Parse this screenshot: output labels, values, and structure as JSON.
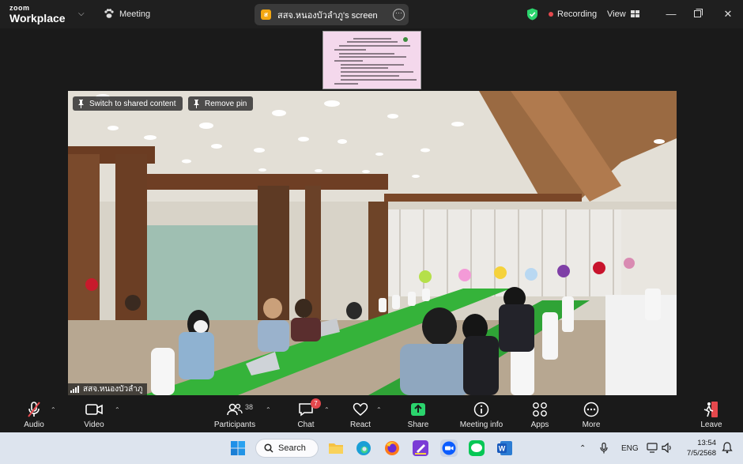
{
  "app": {
    "logo_small": "zoom",
    "logo_big": "Workplace",
    "meeting_label": "Meeting"
  },
  "share": {
    "label": "สสจ.หนองบัวลำภู's screen",
    "avatar_letter": "ส",
    "avatar_color": "#f3a712"
  },
  "status": {
    "recording_label": "Recording",
    "view_label": "View"
  },
  "overlay": {
    "switch_label": "Switch to shared content",
    "remove_pin_label": "Remove pin"
  },
  "video": {
    "participant_name": "สสจ.หนองบัวลำภู"
  },
  "toolbar": {
    "audio": "Audio",
    "video": "Video",
    "participants": "Participants",
    "participants_count": "38",
    "chat": "Chat",
    "chat_badge": "7",
    "react": "React",
    "share": "Share",
    "meeting_info": "Meeting info",
    "apps": "Apps",
    "more": "More",
    "leave": "Leave"
  },
  "taskbar": {
    "search_label": "Search",
    "lang": "ENG",
    "time": "13:54",
    "date": "7/5/2568"
  },
  "colors": {
    "accent_green": "#2bd46d",
    "recording_red": "#e5484d",
    "leave_red": "#e5484d",
    "zoom_blue": "#0b5cff"
  }
}
